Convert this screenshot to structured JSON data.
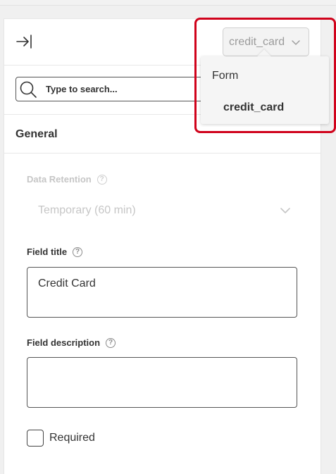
{
  "header": {
    "context_select": {
      "value": "credit_card"
    }
  },
  "search": {
    "placeholder": "Type to search..."
  },
  "section": {
    "title": "General"
  },
  "data_retention": {
    "label": "Data Retention",
    "value": "Temporary (60 min)",
    "help": "?"
  },
  "field_title": {
    "label": "Field title",
    "value": "Credit Card",
    "help": "?"
  },
  "field_description": {
    "label": "Field description",
    "value": "",
    "help": "?"
  },
  "required": {
    "label": "Required",
    "checked": false
  },
  "dropdown": {
    "header": "Form",
    "items": [
      {
        "label": "credit_card"
      }
    ]
  },
  "colors": {
    "highlight": "#d0021b",
    "text": "#333333",
    "disabled_text": "#c6c6c6"
  }
}
